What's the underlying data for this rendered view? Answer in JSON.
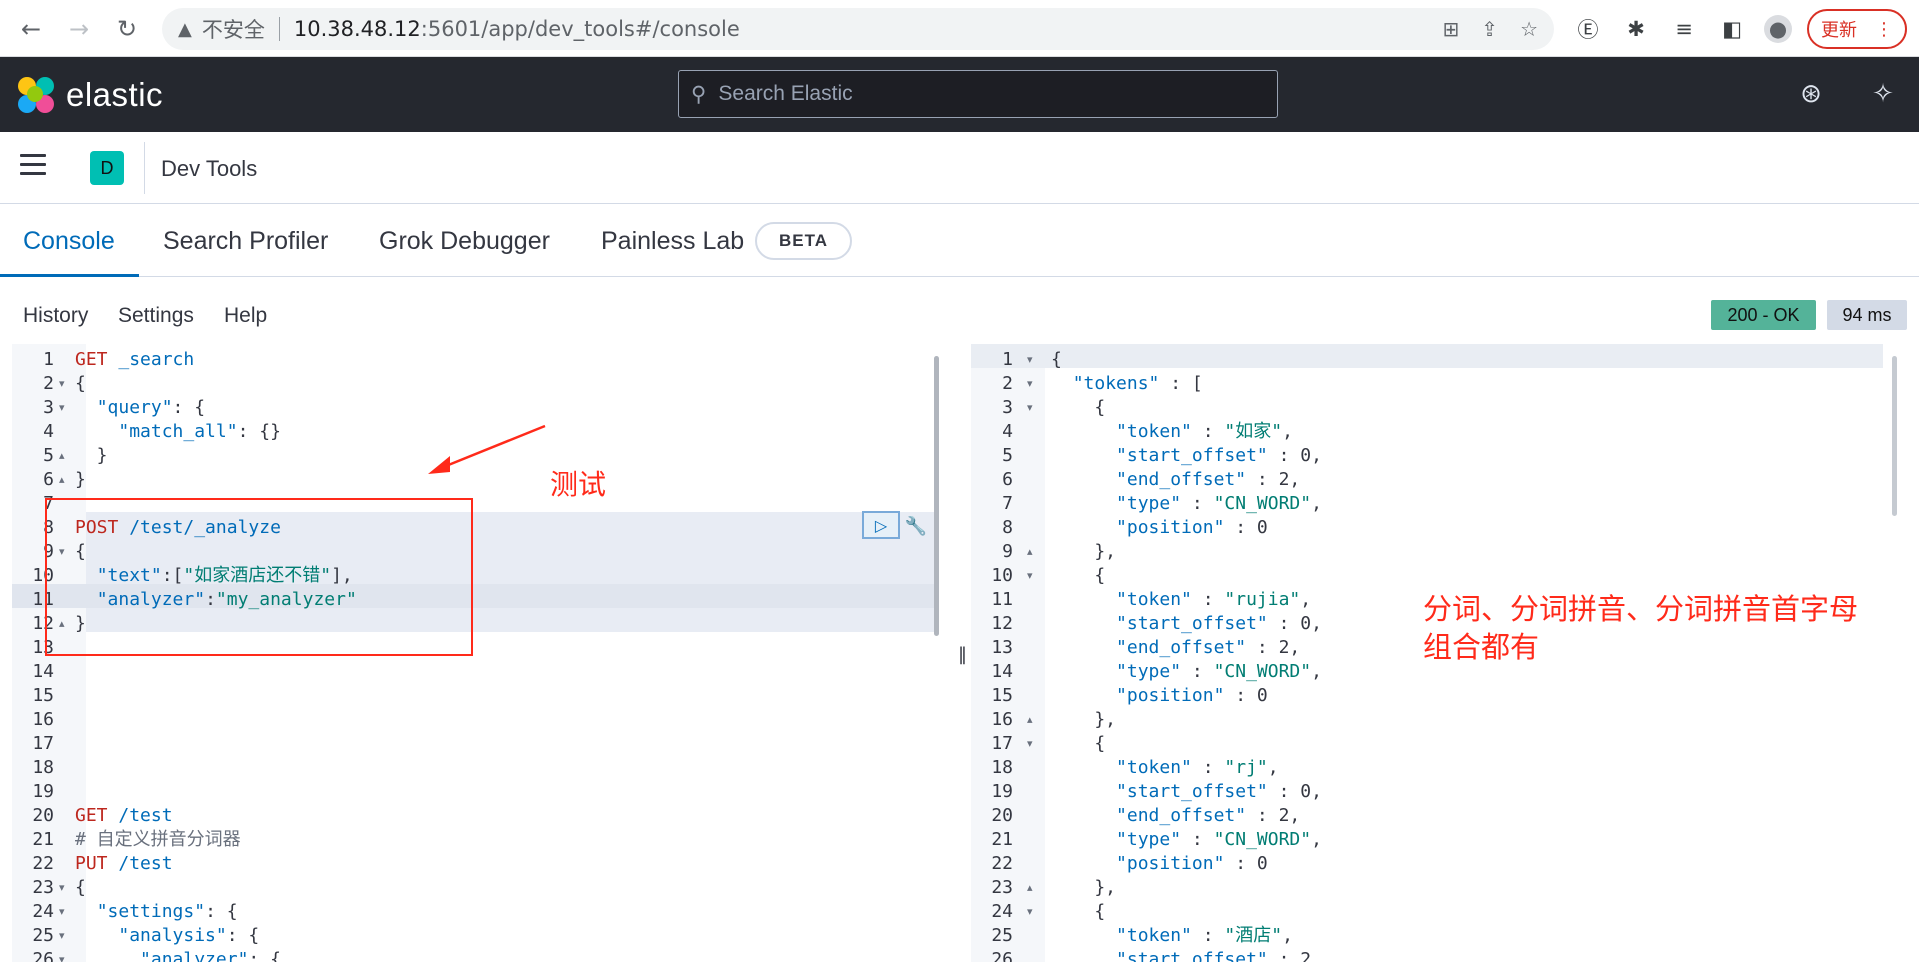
{
  "browser": {
    "insecure_label": "不安全",
    "url_host": "10.38.48.12",
    "url_path": ":5601/app/dev_tools#/console",
    "update_label": "更新"
  },
  "kibana": {
    "logo_text": "elastic",
    "search_placeholder": "Search Elastic",
    "space_initial": "D",
    "breadcrumb": "Dev Tools"
  },
  "tabs": [
    {
      "label": "Console",
      "active": true
    },
    {
      "label": "Search Profiler",
      "active": false
    },
    {
      "label": "Grok Debugger",
      "active": false
    },
    {
      "label": "Painless Lab",
      "active": false
    }
  ],
  "beta_badge": "BETA",
  "console_menu": [
    "History",
    "Settings",
    "Help"
  ],
  "status": {
    "code": "200 - OK",
    "time": "94 ms",
    "color": "#54b399"
  },
  "request_lines": [
    {
      "n": "1",
      "fold": "",
      "t": [
        [
          "k",
          "GET"
        ],
        [
          "p",
          " "
        ],
        [
          "s",
          "_search"
        ]
      ]
    },
    {
      "n": "2",
      "fold": "▾",
      "t": [
        [
          "p",
          "{"
        ]
      ]
    },
    {
      "n": "3",
      "fold": "▾",
      "t": [
        [
          "p",
          "  "
        ],
        [
          "s",
          "\"query\""
        ],
        [
          "p",
          ": {"
        ]
      ]
    },
    {
      "n": "4",
      "fold": "",
      "t": [
        [
          "p",
          "    "
        ],
        [
          "s",
          "\"match_all\""
        ],
        [
          "p",
          ": {}"
        ]
      ]
    },
    {
      "n": "5",
      "fold": "▴",
      "t": [
        [
          "p",
          "  }"
        ]
      ]
    },
    {
      "n": "6",
      "fold": "▴",
      "t": [
        [
          "p",
          "}"
        ]
      ]
    },
    {
      "n": "7",
      "fold": "",
      "t": []
    },
    {
      "n": "8",
      "fold": "",
      "t": [
        [
          "k",
          "POST"
        ],
        [
          "p",
          " "
        ],
        [
          "s",
          "/test/_analyze"
        ]
      ]
    },
    {
      "n": "9",
      "fold": "▾",
      "t": [
        [
          "p",
          "{"
        ]
      ]
    },
    {
      "n": "10",
      "fold": "",
      "t": [
        [
          "p",
          "  "
        ],
        [
          "s",
          "\"text\""
        ],
        [
          "p",
          ":["
        ],
        [
          "v",
          "\"如家酒店还不错\""
        ],
        [
          "p",
          "],"
        ]
      ]
    },
    {
      "n": "11",
      "fold": "",
      "t": [
        [
          "p",
          "  "
        ],
        [
          "s",
          "\"analyzer\""
        ],
        [
          "p",
          ":"
        ],
        [
          "v",
          "\"my_analyzer\""
        ]
      ]
    },
    {
      "n": "12",
      "fold": "▴",
      "t": [
        [
          "p",
          "}"
        ]
      ]
    },
    {
      "n": "13",
      "fold": "",
      "t": []
    },
    {
      "n": "14",
      "fold": "",
      "t": []
    },
    {
      "n": "15",
      "fold": "",
      "t": []
    },
    {
      "n": "16",
      "fold": "",
      "t": []
    },
    {
      "n": "17",
      "fold": "",
      "t": []
    },
    {
      "n": "18",
      "fold": "",
      "t": []
    },
    {
      "n": "19",
      "fold": "",
      "t": []
    },
    {
      "n": "20",
      "fold": "",
      "t": [
        [
          "k",
          "GET"
        ],
        [
          "p",
          " "
        ],
        [
          "s",
          "/test"
        ]
      ]
    },
    {
      "n": "21",
      "fold": "",
      "t": [
        [
          "c",
          "# 自定义拼音分词器"
        ]
      ]
    },
    {
      "n": "22",
      "fold": "",
      "t": [
        [
          "k",
          "PUT"
        ],
        [
          "p",
          " "
        ],
        [
          "s",
          "/test"
        ]
      ]
    },
    {
      "n": "23",
      "fold": "▾",
      "t": [
        [
          "p",
          "{"
        ]
      ]
    },
    {
      "n": "24",
      "fold": "▾",
      "t": [
        [
          "p",
          "  "
        ],
        [
          "s",
          "\"settings\""
        ],
        [
          "p",
          ": {"
        ]
      ]
    },
    {
      "n": "25",
      "fold": "▾",
      "t": [
        [
          "p",
          "    "
        ],
        [
          "s",
          "\"analysis\""
        ],
        [
          "p",
          ": {"
        ]
      ]
    },
    {
      "n": "26",
      "fold": "▾",
      "t": [
        [
          "p",
          "      "
        ],
        [
          "s",
          "\"analyzer\""
        ],
        [
          "p",
          ": {"
        ]
      ]
    }
  ],
  "response_lines": [
    {
      "n": "1",
      "fold": "▾",
      "t": [
        [
          "p",
          "{"
        ]
      ]
    },
    {
      "n": "2",
      "fold": "▾",
      "t": [
        [
          "p",
          "  "
        ],
        [
          "s",
          "\"tokens\""
        ],
        [
          "p",
          " : ["
        ]
      ]
    },
    {
      "n": "3",
      "fold": "▾",
      "t": [
        [
          "p",
          "    {"
        ]
      ]
    },
    {
      "n": "4",
      "fold": "",
      "t": [
        [
          "p",
          "      "
        ],
        [
          "s",
          "\"token\""
        ],
        [
          "p",
          " : "
        ],
        [
          "v",
          "\"如家\""
        ],
        [
          "p",
          ","
        ]
      ]
    },
    {
      "n": "5",
      "fold": "",
      "t": [
        [
          "p",
          "      "
        ],
        [
          "s",
          "\"start_offset\""
        ],
        [
          "p",
          " : 0,"
        ]
      ]
    },
    {
      "n": "6",
      "fold": "",
      "t": [
        [
          "p",
          "      "
        ],
        [
          "s",
          "\"end_offset\""
        ],
        [
          "p",
          " : 2,"
        ]
      ]
    },
    {
      "n": "7",
      "fold": "",
      "t": [
        [
          "p",
          "      "
        ],
        [
          "s",
          "\"type\""
        ],
        [
          "p",
          " : "
        ],
        [
          "v",
          "\"CN_WORD\""
        ],
        [
          "p",
          ","
        ]
      ]
    },
    {
      "n": "8",
      "fold": "",
      "t": [
        [
          "p",
          "      "
        ],
        [
          "s",
          "\"position\""
        ],
        [
          "p",
          " : 0"
        ]
      ]
    },
    {
      "n": "9",
      "fold": "▴",
      "t": [
        [
          "p",
          "    },"
        ]
      ]
    },
    {
      "n": "10",
      "fold": "▾",
      "t": [
        [
          "p",
          "    {"
        ]
      ]
    },
    {
      "n": "11",
      "fold": "",
      "t": [
        [
          "p",
          "      "
        ],
        [
          "s",
          "\"token\""
        ],
        [
          "p",
          " : "
        ],
        [
          "v",
          "\"rujia\""
        ],
        [
          "p",
          ","
        ]
      ]
    },
    {
      "n": "12",
      "fold": "",
      "t": [
        [
          "p",
          "      "
        ],
        [
          "s",
          "\"start_offset\""
        ],
        [
          "p",
          " : 0,"
        ]
      ]
    },
    {
      "n": "13",
      "fold": "",
      "t": [
        [
          "p",
          "      "
        ],
        [
          "s",
          "\"end_offset\""
        ],
        [
          "p",
          " : 2,"
        ]
      ]
    },
    {
      "n": "14",
      "fold": "",
      "t": [
        [
          "p",
          "      "
        ],
        [
          "s",
          "\"type\""
        ],
        [
          "p",
          " : "
        ],
        [
          "v",
          "\"CN_WORD\""
        ],
        [
          "p",
          ","
        ]
      ]
    },
    {
      "n": "15",
      "fold": "",
      "t": [
        [
          "p",
          "      "
        ],
        [
          "s",
          "\"position\""
        ],
        [
          "p",
          " : 0"
        ]
      ]
    },
    {
      "n": "16",
      "fold": "▴",
      "t": [
        [
          "p",
          "    },"
        ]
      ]
    },
    {
      "n": "17",
      "fold": "▾",
      "t": [
        [
          "p",
          "    {"
        ]
      ]
    },
    {
      "n": "18",
      "fold": "",
      "t": [
        [
          "p",
          "      "
        ],
        [
          "s",
          "\"token\""
        ],
        [
          "p",
          " : "
        ],
        [
          "v",
          "\"rj\""
        ],
        [
          "p",
          ","
        ]
      ]
    },
    {
      "n": "19",
      "fold": "",
      "t": [
        [
          "p",
          "      "
        ],
        [
          "s",
          "\"start_offset\""
        ],
        [
          "p",
          " : 0,"
        ]
      ]
    },
    {
      "n": "20",
      "fold": "",
      "t": [
        [
          "p",
          "      "
        ],
        [
          "s",
          "\"end_offset\""
        ],
        [
          "p",
          " : 2,"
        ]
      ]
    },
    {
      "n": "21",
      "fold": "",
      "t": [
        [
          "p",
          "      "
        ],
        [
          "s",
          "\"type\""
        ],
        [
          "p",
          " : "
        ],
        [
          "v",
          "\"CN_WORD\""
        ],
        [
          "p",
          ","
        ]
      ]
    },
    {
      "n": "22",
      "fold": "",
      "t": [
        [
          "p",
          "      "
        ],
        [
          "s",
          "\"position\""
        ],
        [
          "p",
          " : 0"
        ]
      ]
    },
    {
      "n": "23",
      "fold": "▴",
      "t": [
        [
          "p",
          "    },"
        ]
      ]
    },
    {
      "n": "24",
      "fold": "▾",
      "t": [
        [
          "p",
          "    {"
        ]
      ]
    },
    {
      "n": "25",
      "fold": "",
      "t": [
        [
          "p",
          "      "
        ],
        [
          "s",
          "\"token\""
        ],
        [
          "p",
          " : "
        ],
        [
          "v",
          "\"酒店\""
        ],
        [
          "p",
          ","
        ]
      ]
    },
    {
      "n": "26",
      "fold": "",
      "t": [
        [
          "p",
          "      "
        ],
        [
          "s",
          "\"start_offset\""
        ],
        [
          "p",
          " : 2,"
        ]
      ]
    }
  ],
  "annotations": {
    "test_label": "测试",
    "note_line1": "分词、分词拼音、分词拼音首字母",
    "note_line2": "组合都有",
    "color": "#ff2a1a"
  },
  "icons": {
    "back": "arrow-left-icon",
    "forward": "arrow-right-icon",
    "reload": "reload-icon",
    "search": "search-icon",
    "help": "help-icon",
    "news": "newsfeed-icon",
    "run": "play-icon",
    "wrench": "wrench-icon"
  }
}
